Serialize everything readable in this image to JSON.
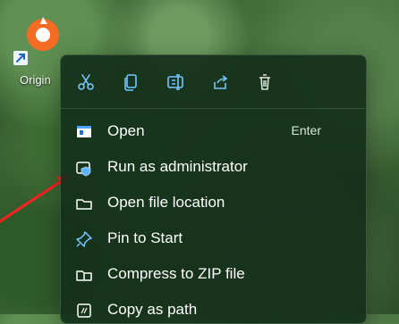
{
  "desktop": {
    "icon_label": "Origin",
    "icon_name": "origin-app-icon"
  },
  "toolbar": {
    "icons": [
      "scissors-icon",
      "copy-icon",
      "rename-icon",
      "share-icon",
      "trash-icon"
    ]
  },
  "menu": {
    "items": [
      {
        "label": "Open",
        "shortcut": "Enter",
        "icon": "open-icon"
      },
      {
        "label": "Run as administrator",
        "icon": "admin-shield-icon"
      },
      {
        "label": "Open file location",
        "icon": "folder-icon"
      },
      {
        "label": "Pin to Start",
        "icon": "pin-icon"
      },
      {
        "label": "Compress to ZIP file",
        "icon": "zip-folder-icon"
      },
      {
        "label": "Copy as path",
        "icon": "copy-path-icon"
      }
    ]
  },
  "colors": {
    "menu_bg": "#132f1a",
    "accent": "#5fb3ff",
    "arrow": "#ff2020",
    "origin_orange": "#f56d22"
  }
}
